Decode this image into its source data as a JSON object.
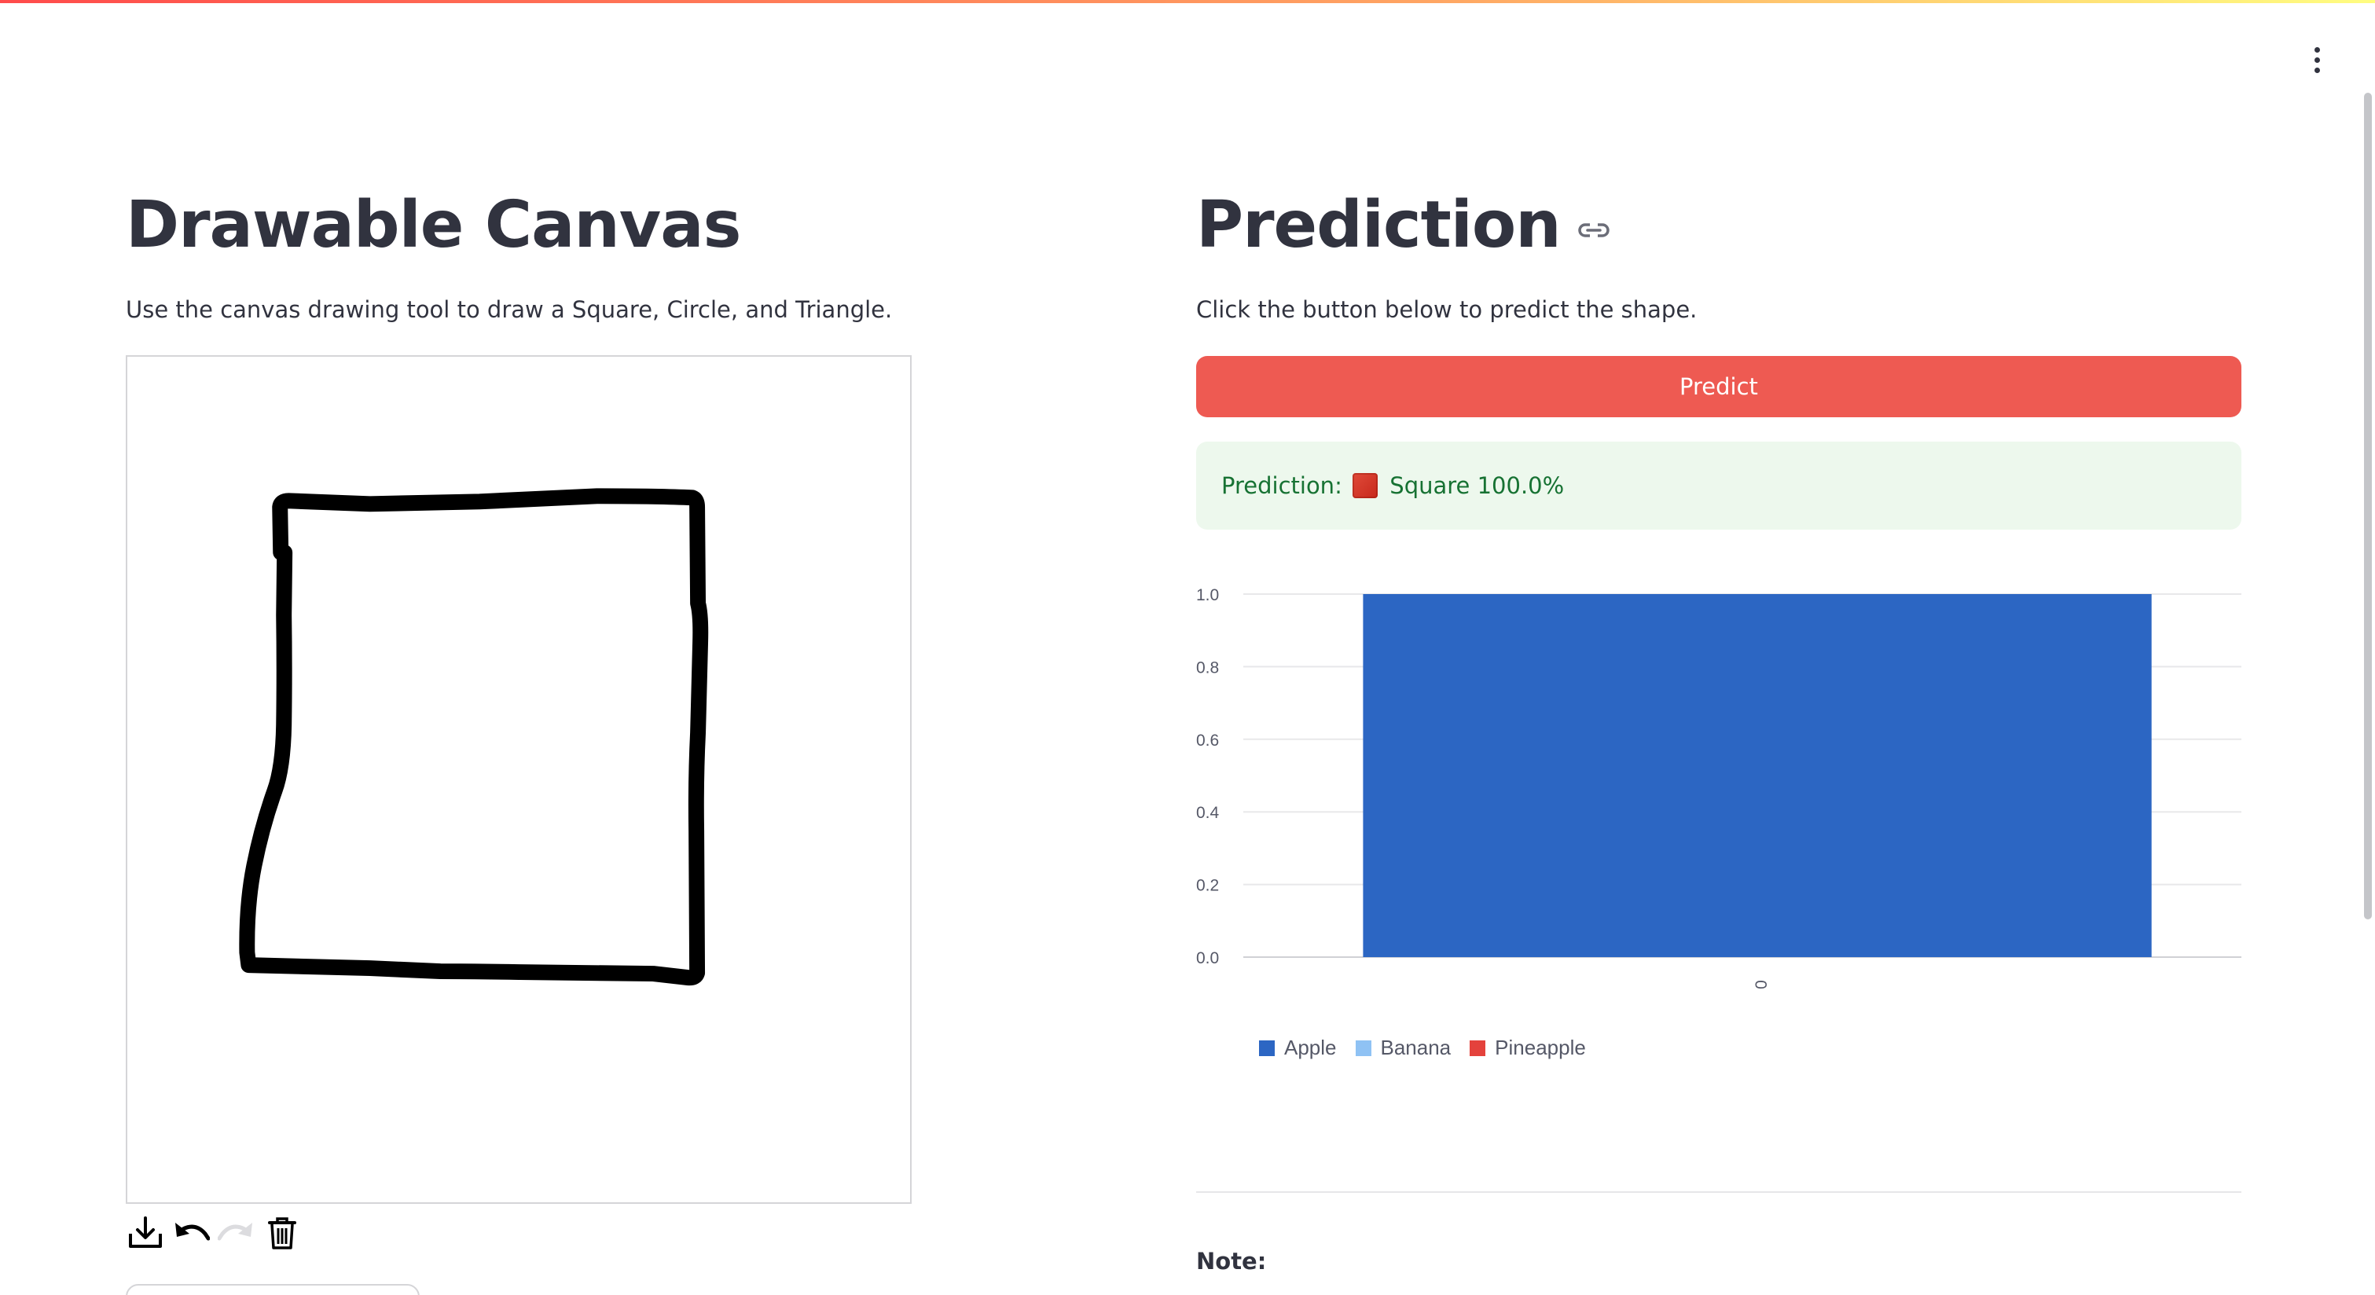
{
  "app": {
    "colors": {
      "primary": "#ee5a52",
      "text": "#31333f",
      "success_bg": "#edf8ed",
      "success_text": "#177233"
    }
  },
  "header": {
    "menu_icon": "vertical-dots-icon"
  },
  "canvas_section": {
    "title": "Drawable Canvas",
    "description": "Use the canvas drawing tool to draw a Square, Circle, and Triangle.",
    "drawing": "hand-drawn square in black stroke",
    "toolbar": [
      {
        "icon": "download-icon",
        "enabled": true
      },
      {
        "icon": "undo-icon",
        "enabled": true
      },
      {
        "icon": "redo-icon",
        "enabled": false
      },
      {
        "icon": "trash-icon",
        "enabled": true
      }
    ]
  },
  "prediction_section": {
    "title": "Prediction",
    "link_icon": "link-icon",
    "description": "Click the button below to predict the shape.",
    "predict_label": "Predict",
    "result_prefix": "Prediction: ",
    "result_emoji": "red-square-emoji",
    "result_text": " Square 100.0%",
    "note_label": "Note:"
  },
  "chart_data": {
    "type": "bar",
    "categories": [
      "0"
    ],
    "series": [
      {
        "name": "Apple",
        "values": [
          1.0
        ],
        "color": "#2c66c3"
      },
      {
        "name": "Banana",
        "values": [
          0.0
        ],
        "color": "#8fc2f4"
      },
      {
        "name": "Pineapple",
        "values": [
          0.0
        ],
        "color": "#e4423c"
      }
    ],
    "title": "",
    "xlabel": "",
    "ylabel": "",
    "ylim": [
      0,
      1.0
    ],
    "yticks": [
      "0.0",
      "0.2",
      "0.4",
      "0.6",
      "0.8",
      "1.0"
    ],
    "grid": true,
    "legend_position": "bottom-left"
  }
}
